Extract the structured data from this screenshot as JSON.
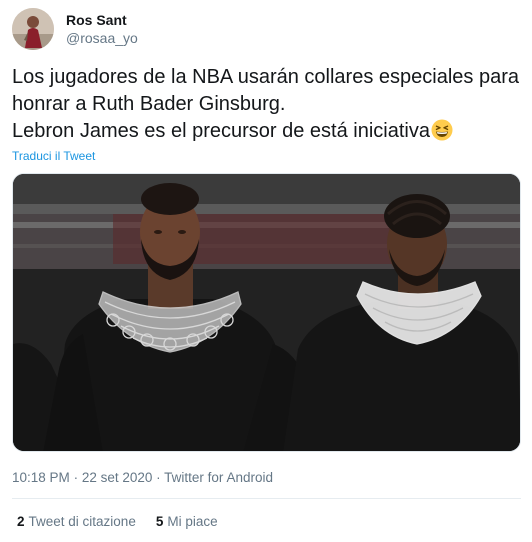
{
  "user": {
    "display_name": "Ros Sant",
    "handle": "@rosaa_yo"
  },
  "tweet": {
    "lines": [
      "Los jugadores de la NBA usarán collares especiales para",
      "honrar a Ruth Bader Ginsburg.",
      "Lebron James es el precursor de está iniciativa"
    ],
    "emoji": "grinning-squinting-face-icon",
    "translate_label": "Traduci il Tweet"
  },
  "meta": {
    "time": "10:18 PM",
    "separator": "·",
    "date": "22 set 2020",
    "source": "Twitter for Android"
  },
  "stats": {
    "quote_count": "2",
    "quote_label": "Tweet di citazione",
    "like_count": "5",
    "like_label": "Mi piace"
  },
  "colors": {
    "link": "#1b95e0",
    "secondary_text": "#657786",
    "primary_text": "#14171a",
    "divider": "#e6ecf0"
  }
}
